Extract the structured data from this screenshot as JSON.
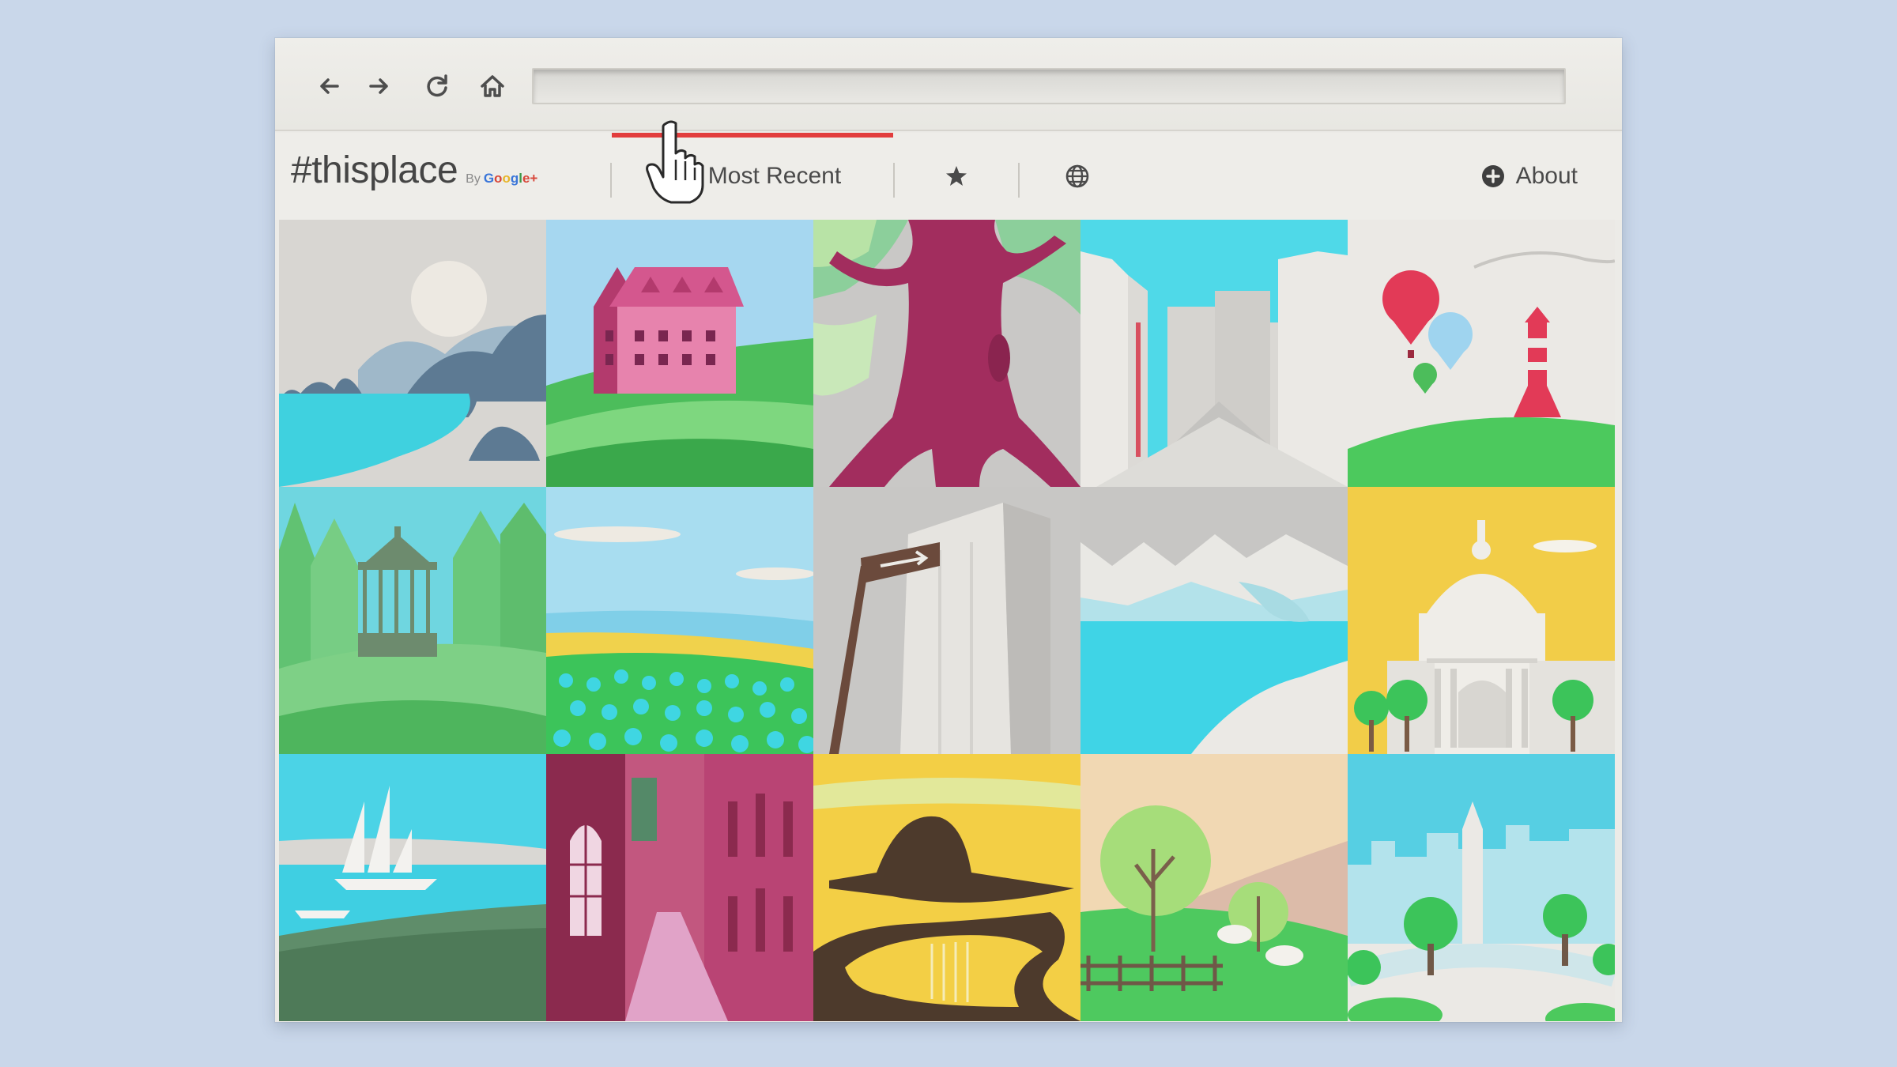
{
  "browser": {
    "back_icon": "arrow-left-icon",
    "forward_icon": "arrow-right-icon",
    "reload_icon": "reload-icon",
    "home_icon": "home-icon",
    "address": ""
  },
  "site": {
    "logo": "#thisplace",
    "logo_by": "By",
    "logo_google": [
      "G",
      "o",
      "o",
      "g",
      "l",
      "e",
      "+"
    ],
    "tabs": [
      {
        "label": "Most Recent",
        "icon": "clock-icon",
        "active": true
      },
      {
        "label": "",
        "icon": "star-icon",
        "active": false
      },
      {
        "label": "",
        "icon": "globe-icon",
        "active": false
      }
    ],
    "about_label": "About",
    "about_icon": "plus-circle-icon",
    "accent_color": "#e23d3d"
  },
  "grid": {
    "tiles": [
      {
        "name": "coastal-rocks-moon"
      },
      {
        "name": "pink-house-field"
      },
      {
        "name": "giant-tree-trunk"
      },
      {
        "name": "white-city-buildings"
      },
      {
        "name": "balloons-lighthouse"
      },
      {
        "name": "forest-gazebo"
      },
      {
        "name": "tulip-field-lake"
      },
      {
        "name": "signpost-tower"
      },
      {
        "name": "mountain-lake"
      },
      {
        "name": "capitol-dome-trees"
      },
      {
        "name": "sailboat-bay"
      },
      {
        "name": "red-alley-street"
      },
      {
        "name": "golden-river-mountain"
      },
      {
        "name": "trees-sheep-fence"
      },
      {
        "name": "park-monument-skyline"
      }
    ]
  }
}
